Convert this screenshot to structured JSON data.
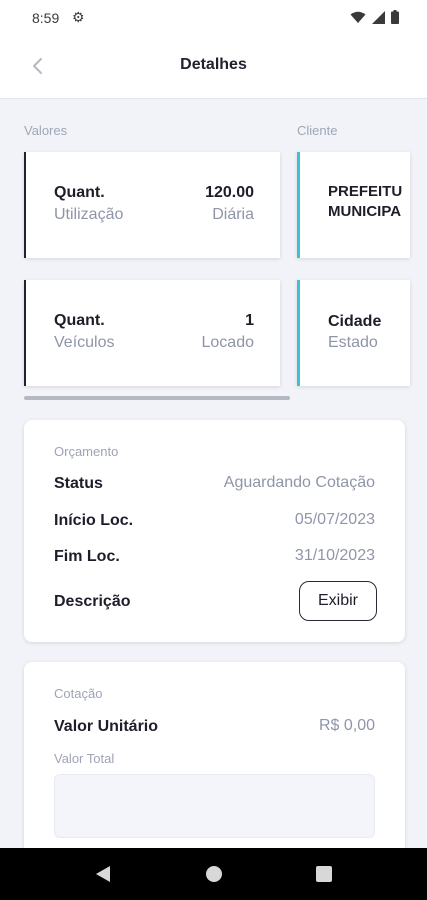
{
  "status_bar": {
    "time": "8:59"
  },
  "header": {
    "title": "Detalhes"
  },
  "sections": {
    "valores": "Valores",
    "cliente": "Cliente"
  },
  "valores_cards": [
    {
      "l1": "Quant.",
      "l2": "Utilização",
      "r1": "120.00",
      "r2": "Diária"
    },
    {
      "l1": "Quant.",
      "l2": "Veículos",
      "r1": "1",
      "r2": "Locado"
    }
  ],
  "cliente_cards": [
    {
      "line1": "PREFEITU",
      "line2": "MUNICIPA"
    },
    {
      "line1": "Cidade",
      "line2": "Estado"
    }
  ],
  "orcamento": {
    "heading": "Orçamento",
    "status_label": "Status",
    "status_value": "Aguardando Cotação",
    "inicio_label": "Início Loc.",
    "inicio_value": "05/07/2023",
    "fim_label": "Fim Loc.",
    "fim_value": "31/10/2023",
    "descricao_label": "Descrição",
    "exibir_button": "Exibir"
  },
  "cotacao": {
    "heading": "Cotação",
    "valor_unitario_label": "Valor Unitário",
    "valor_unitario_value": "R$ 0,00",
    "valor_total_label": "Valor Total",
    "valor_total_value": ""
  },
  "colors": {
    "accent_dark": "#1e2233",
    "accent_teal": "#3cc3cf",
    "background": "#f1f3f8"
  }
}
